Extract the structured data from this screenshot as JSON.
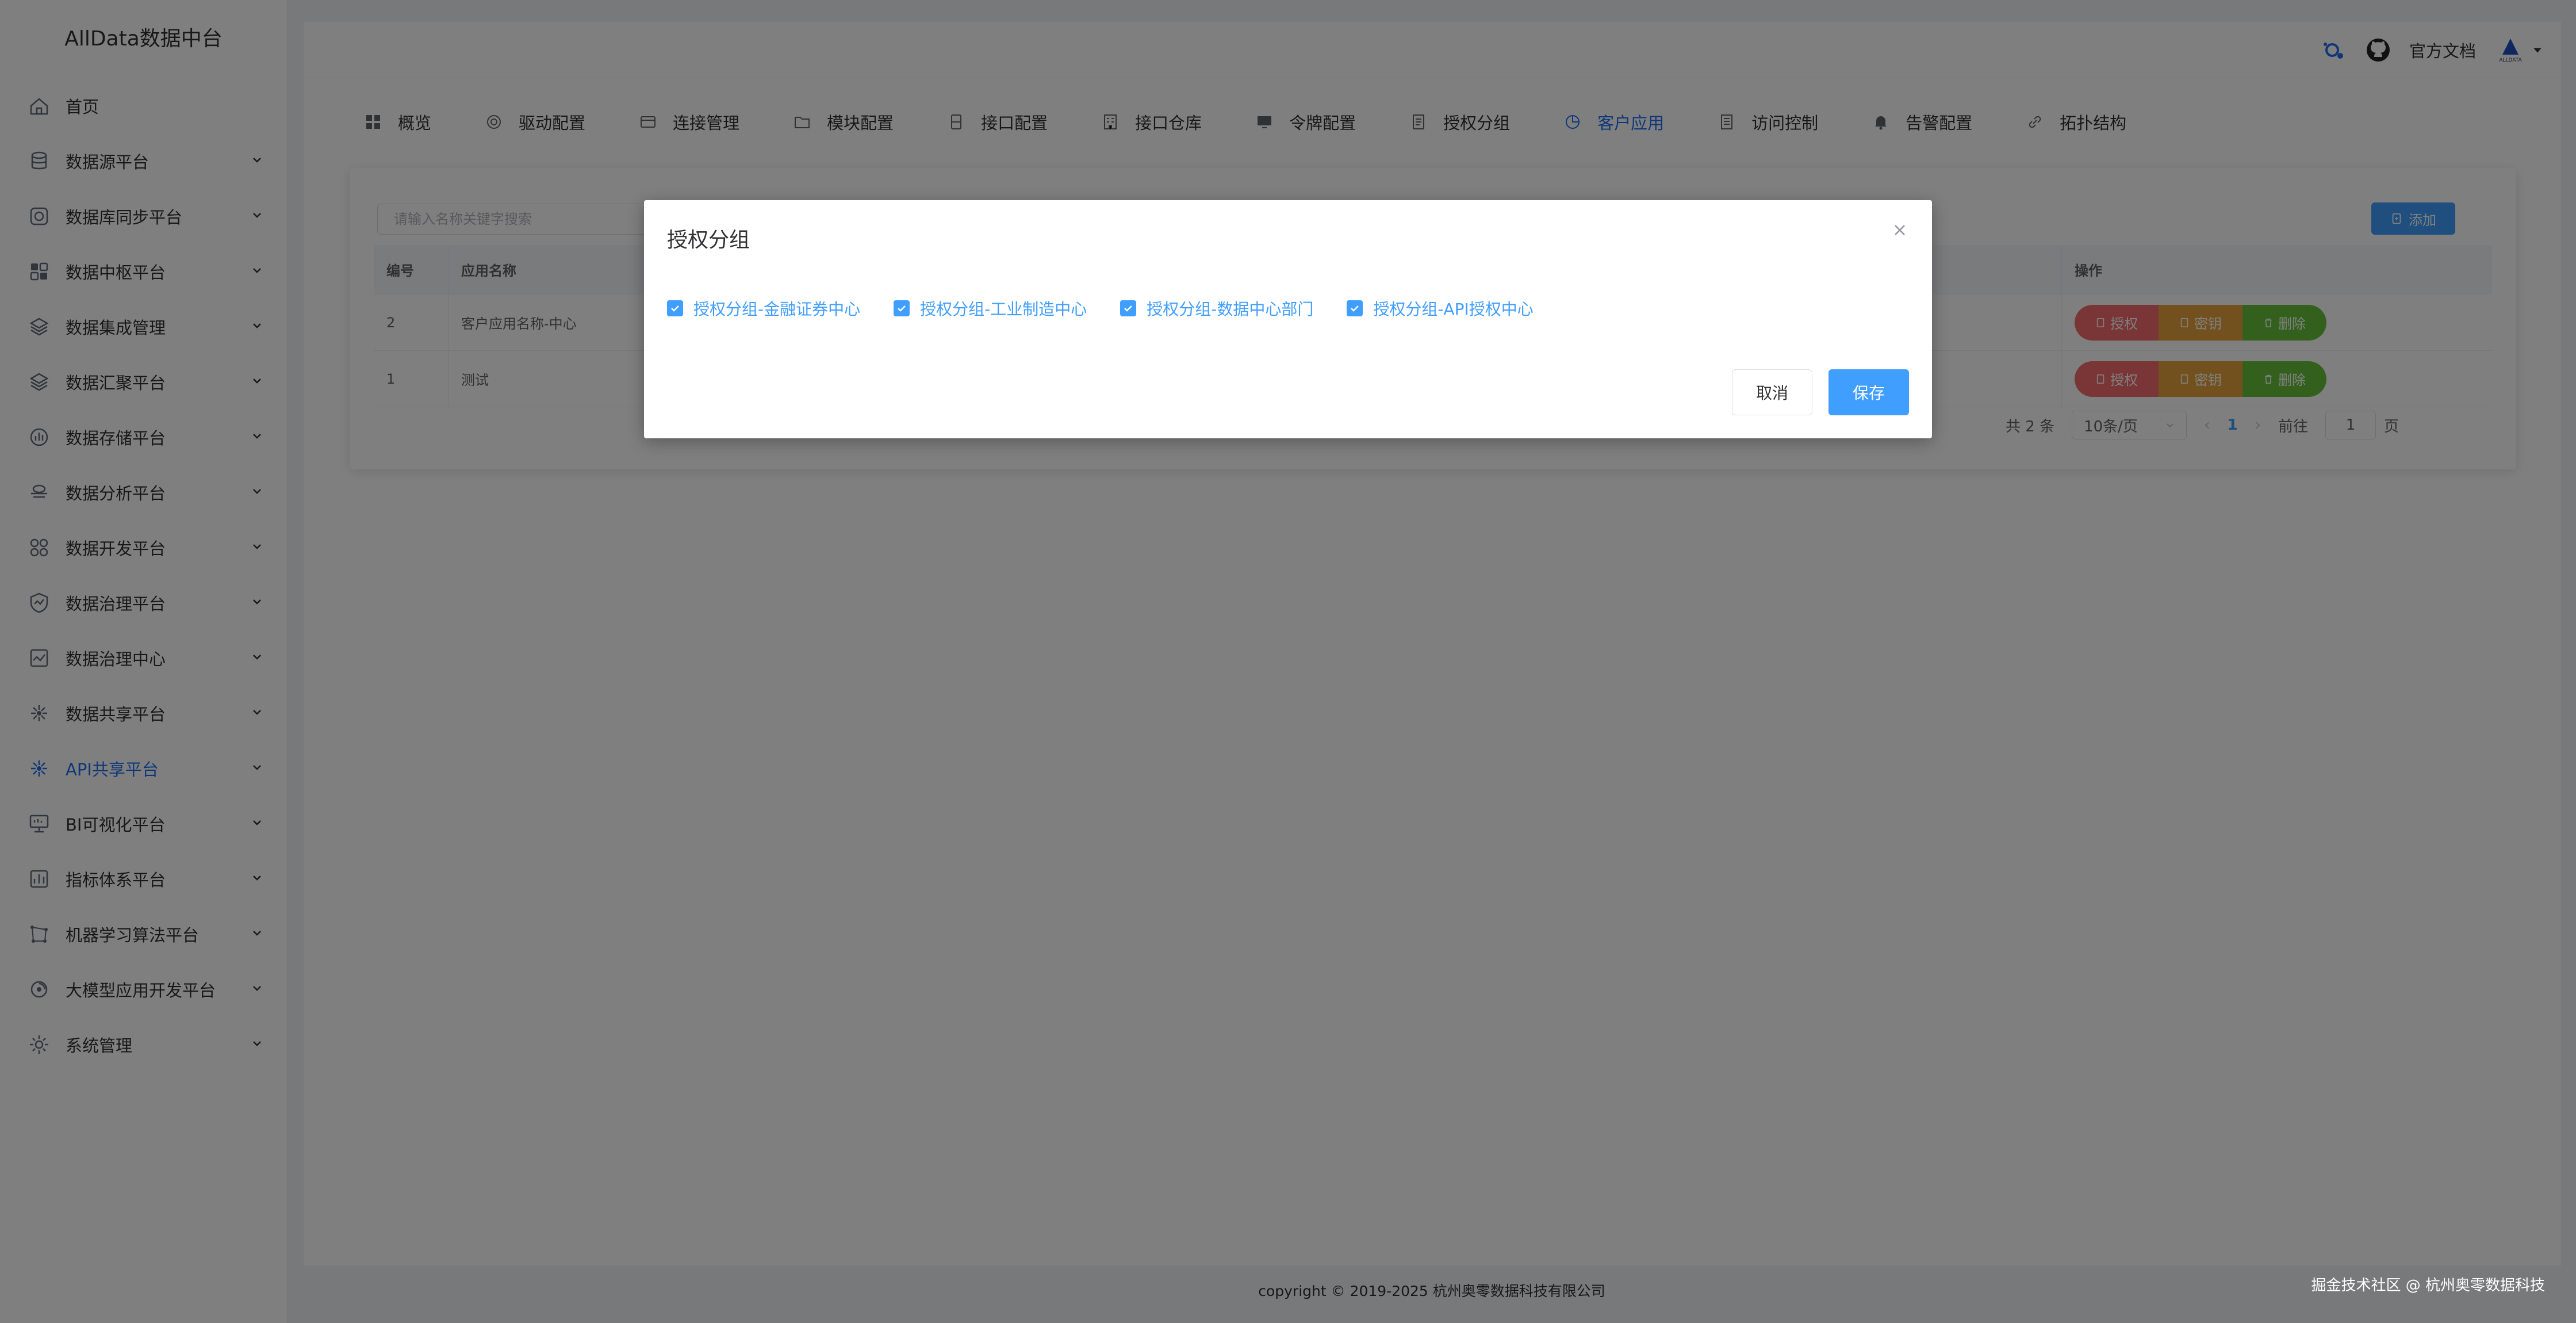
{
  "app": {
    "title": "AllData数据中台"
  },
  "sidebar": {
    "items": [
      {
        "label": "首页",
        "icon": "home-icon"
      },
      {
        "label": "数据源平台",
        "icon": "database-icon"
      },
      {
        "label": "数据库同步平台",
        "icon": "sync-icon"
      },
      {
        "label": "数据中枢平台",
        "icon": "hub-icon"
      },
      {
        "label": "数据集成管理",
        "icon": "layers-icon"
      },
      {
        "label": "数据汇聚平台",
        "icon": "converge-icon"
      },
      {
        "label": "数据存储平台",
        "icon": "storage-icon"
      },
      {
        "label": "数据分析平台",
        "icon": "analysis-icon"
      },
      {
        "label": "数据开发平台",
        "icon": "develop-icon"
      },
      {
        "label": "数据治理平台",
        "icon": "governance-icon"
      },
      {
        "label": "数据治理中心",
        "icon": "governance-center-icon"
      },
      {
        "label": "数据共享平台",
        "icon": "share-icon"
      },
      {
        "label": "API共享平台",
        "icon": "api-share-icon",
        "active": true
      },
      {
        "label": "BI可视化平台",
        "icon": "monitor-icon"
      },
      {
        "label": "指标体系平台",
        "icon": "metrics-icon"
      },
      {
        "label": "机器学习算法平台",
        "icon": "ml-icon"
      },
      {
        "label": "大模型应用开发平台",
        "icon": "llm-icon"
      },
      {
        "label": "系统管理",
        "icon": "settings-icon"
      }
    ]
  },
  "header": {
    "docs_label": "官方文档",
    "logo_text": "ALLDATA"
  },
  "tabs": [
    {
      "label": "概览",
      "icon": "grid-icon"
    },
    {
      "label": "驱动配置",
      "icon": "driver-icon"
    },
    {
      "label": "连接管理",
      "icon": "connection-icon"
    },
    {
      "label": "模块配置",
      "icon": "folder-icon"
    },
    {
      "label": "接口配置",
      "icon": "interface-icon"
    },
    {
      "label": "接口仓库",
      "icon": "warehouse-icon"
    },
    {
      "label": "令牌配置",
      "icon": "token-icon"
    },
    {
      "label": "授权分组",
      "icon": "document-icon"
    },
    {
      "label": "客户应用",
      "icon": "pie-icon",
      "active": true
    },
    {
      "label": "访问控制",
      "icon": "access-icon"
    },
    {
      "label": "告警配置",
      "icon": "bell-icon"
    },
    {
      "label": "拓扑结构",
      "icon": "link-icon"
    }
  ],
  "list": {
    "search_placeholder": "请输入名称关键字搜索",
    "add_label": "添加",
    "columns": {
      "id": "编号",
      "name": "应用名称",
      "op": "操作"
    },
    "rows": [
      {
        "id": "2",
        "name": "客户应用名称-中心"
      },
      {
        "id": "1",
        "name": "测试"
      }
    ],
    "actions": {
      "authorize": "授权",
      "secret": "密钥",
      "delete": "删除"
    }
  },
  "pagination": {
    "total_text": "共 2 条",
    "page_size": "10条/页",
    "current_page": "1",
    "goto_prefix": "前往",
    "goto_value": "1",
    "goto_suffix": "页"
  },
  "footer": {
    "copyright": "copyright © 2019-2025 杭州奥零数据科技有限公司"
  },
  "watermark": "掘金技术社区 @ 杭州奥零数据科技",
  "dialog": {
    "title": "授权分组",
    "options": [
      {
        "label": "授权分组-金融证券中心",
        "checked": true
      },
      {
        "label": "授权分组-工业制造中心",
        "checked": true
      },
      {
        "label": "授权分组-数据中心部门",
        "checked": true
      },
      {
        "label": "授权分组-API授权中心",
        "checked": true
      }
    ],
    "cancel_label": "取消",
    "save_label": "保存"
  },
  "colors": {
    "primary": "#409eff",
    "active_nav": "#1f6ef0",
    "danger": "#f56c6c",
    "warning": "#e6a23c",
    "success": "#67c23a"
  }
}
